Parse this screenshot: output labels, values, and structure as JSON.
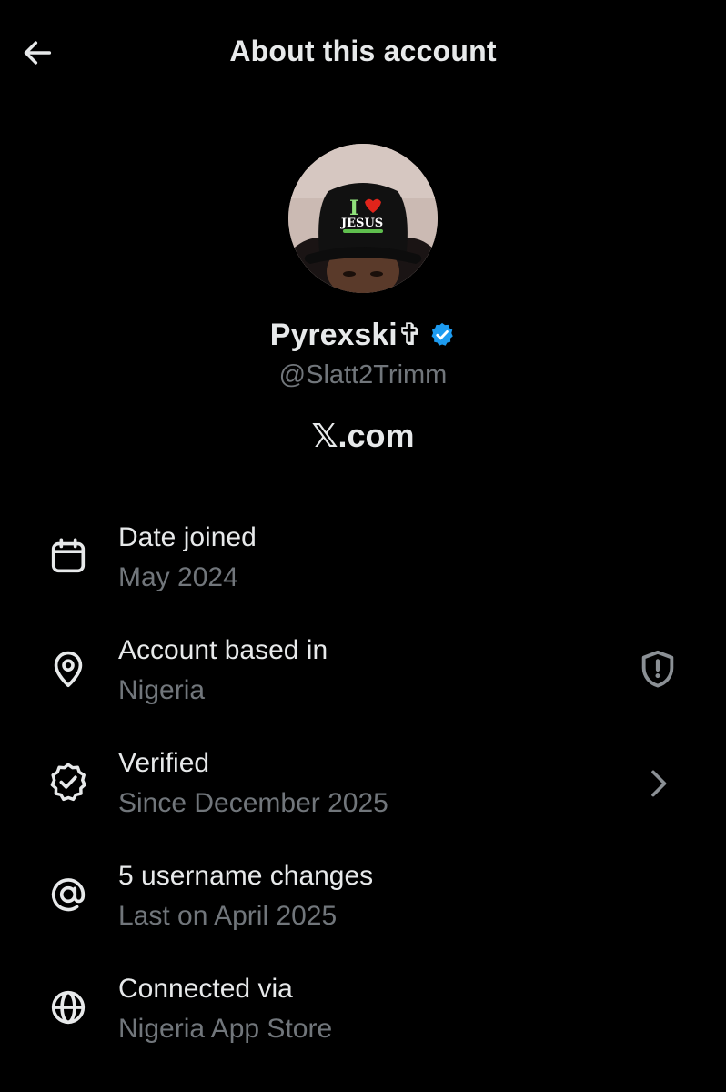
{
  "header": {
    "title": "About this account",
    "back_icon": "arrow-left-icon"
  },
  "profile": {
    "display_name": "Pyrexski✞",
    "username": "@Slatt2Trimm",
    "site": "𝕏.com",
    "avatar_text": {
      "line1": "I",
      "line2": "JESUS"
    },
    "verified_color": "#1d9bf0"
  },
  "rows": [
    {
      "icon": "calendar-icon",
      "title": "Date joined",
      "subtitle": "May 2024",
      "trailing": ""
    },
    {
      "icon": "location-pin-icon",
      "title": "Account based in",
      "subtitle": "Nigeria",
      "trailing": "shield-alert-icon"
    },
    {
      "icon": "verified-seal-icon",
      "title": "Verified",
      "subtitle": "Since December 2025",
      "trailing": "chevron-right-icon"
    },
    {
      "icon": "at-sign-icon",
      "title": "5 username changes",
      "subtitle": "Last on April 2025",
      "trailing": ""
    },
    {
      "icon": "globe-icon",
      "title": "Connected via",
      "subtitle": "Nigeria App Store",
      "trailing": ""
    }
  ],
  "colors": {
    "background": "#000000",
    "primary_text": "#e7e9ea",
    "secondary_text": "#71767b",
    "accent": "#1d9bf0"
  }
}
